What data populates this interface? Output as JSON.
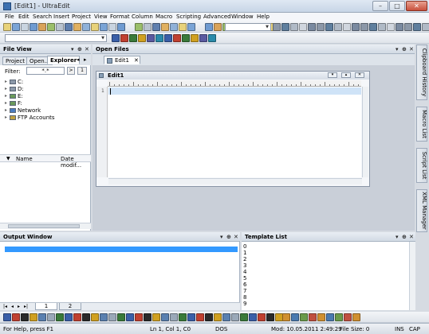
{
  "window": {
    "title": "[Edit1] - UltraEdit"
  },
  "menu": [
    "File",
    "Edit",
    "Search",
    "Insert",
    "Project",
    "View",
    "Format",
    "Column",
    "Macro",
    "Scripting",
    "Advanced",
    "Window",
    "Help"
  ],
  "file_view": {
    "title": "File View",
    "tabs": [
      "Project",
      "Open...",
      "Explorer"
    ],
    "filter_label": "Filter:",
    "filter_value": "*.*",
    "filter_btn1": ">",
    "filter_btn2": "1",
    "tree": [
      "C:",
      "D:",
      "E:",
      "F:",
      "Network",
      "FTP Accounts"
    ],
    "columns": {
      "name": "Name",
      "date": "Date modif..."
    }
  },
  "open_files": {
    "title": "Open Files",
    "tab": "Edit1"
  },
  "editor": {
    "title": "Edit1",
    "line1": "1"
  },
  "output": {
    "title": "Output Window",
    "tabs": [
      "1",
      "2"
    ]
  },
  "template": {
    "title": "Template List",
    "items": [
      "0",
      "1",
      "2",
      "3",
      "4",
      "5",
      "6",
      "7",
      "8",
      "9"
    ]
  },
  "side_tabs": [
    "Clipboard History",
    "Macro List",
    "Script List",
    "XML Manager"
  ],
  "status": {
    "help": "For Help, press F1",
    "position": "Ln 1, Col 1, C0",
    "format": "DOS",
    "modified": "Mod: 10.05.2011 2:49:29",
    "size": "File Size: 0",
    "ins": "INS",
    "cap": "CAP"
  },
  "colors": {
    "accent": "#3399ff",
    "selection": "#cfe3f7"
  }
}
